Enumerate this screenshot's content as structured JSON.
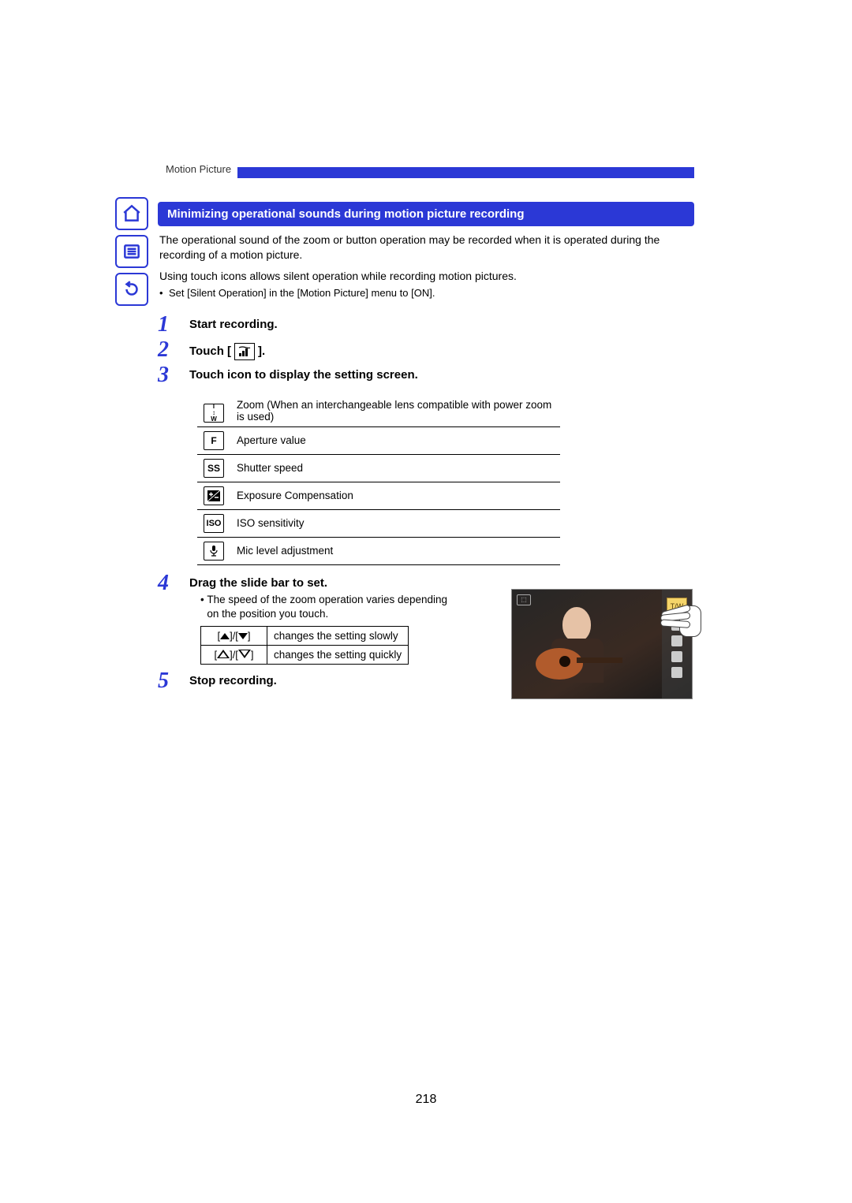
{
  "breadcrumb": "Motion Picture",
  "section_title": "Minimizing operational sounds during motion picture recording",
  "intro": [
    "The operational sound of the zoom or button operation may be recorded when it is operated during the recording of a motion picture.",
    "Using touch icons allows silent operation while recording motion pictures."
  ],
  "intro_bullet": "Set [Silent Operation] in the [Motion Picture] menu to [ON].",
  "steps": {
    "1": {
      "num": "1",
      "title": "Start recording."
    },
    "2": {
      "num": "2",
      "title_prefix": "Touch [",
      "title_suffix": "]."
    },
    "3": {
      "num": "3",
      "title": "Touch icon to display the setting screen."
    },
    "4": {
      "num": "4",
      "title": "Drag the slide bar to set.",
      "note": "The speed of the zoom operation varies depending on the position you touch."
    },
    "5": {
      "num": "5",
      "title": "Stop recording."
    }
  },
  "settings_table": [
    {
      "icon": "T↕W",
      "label": "Zoom (When an interchangeable lens compatible with power zoom is used)"
    },
    {
      "icon": "F",
      "label": "Aperture value"
    },
    {
      "icon": "SS",
      "label": "Shutter speed"
    },
    {
      "icon": "☑",
      "label": "Exposure Compensation"
    },
    {
      "icon": "ISO",
      "label": "ISO sensitivity"
    },
    {
      "icon": "🎤",
      "label": "Mic level adjustment"
    }
  ],
  "speed_table": [
    {
      "label": "changes the setting slowly"
    },
    {
      "label": "changes the setting quickly"
    }
  ],
  "page_number": "218",
  "nav": {
    "home": "home-icon",
    "contents": "contents-icon",
    "back": "back-icon"
  }
}
